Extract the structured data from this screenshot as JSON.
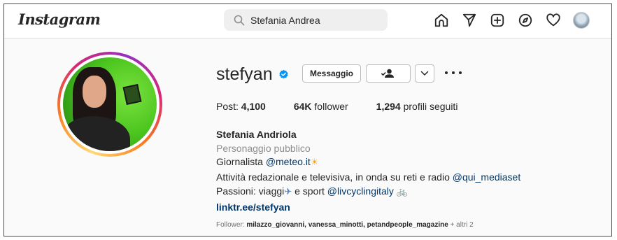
{
  "header": {
    "logo": "Instagram",
    "search_value": "Stefania Andrea",
    "nav_icons": [
      "home-icon",
      "send-icon",
      "new-post-icon",
      "explore-icon",
      "heart-icon",
      "profile-avatar"
    ]
  },
  "profile": {
    "username": "stefyan",
    "verified": true,
    "buttons": {
      "message": "Messaggio",
      "follow_icon": "person-check-icon",
      "dropdown_icon": "chevron-down-icon",
      "more_icon": "more-options-icon"
    },
    "stats": {
      "posts_label": "Post:",
      "posts_value": "4,100",
      "followers_value": "64K",
      "followers_label": "follower",
      "following_value": "1,294",
      "following_label": "profili seguiti"
    },
    "bio": {
      "full_name": "Stefania Andriola",
      "category": "Personaggio pubblico",
      "line1_text": "Giornalista ",
      "line1_mention": "@meteo.it",
      "line1_emoji": "☀",
      "line2_text": "Attività redazionale e televisiva, in onda su reti e radio ",
      "line2_mention": "@qui_mediaset",
      "line3_text_a": "Passioni: viaggi",
      "line3_emoji_a": "✈",
      "line3_text_b": " e sport ",
      "line3_mention": "@livcyclingitaly",
      "line3_emoji_b": "🚲",
      "link": "linktr.ee/stefyan"
    },
    "followed_by": {
      "prefix": "Follower: ",
      "names": "milazzo_giovanni, vanessa_minotti, petandpeople_magazine",
      "suffix": " + altri 2"
    }
  },
  "colors": {
    "link": "#00376b",
    "verified": "#0095f6",
    "muted": "#8e8e8e"
  }
}
